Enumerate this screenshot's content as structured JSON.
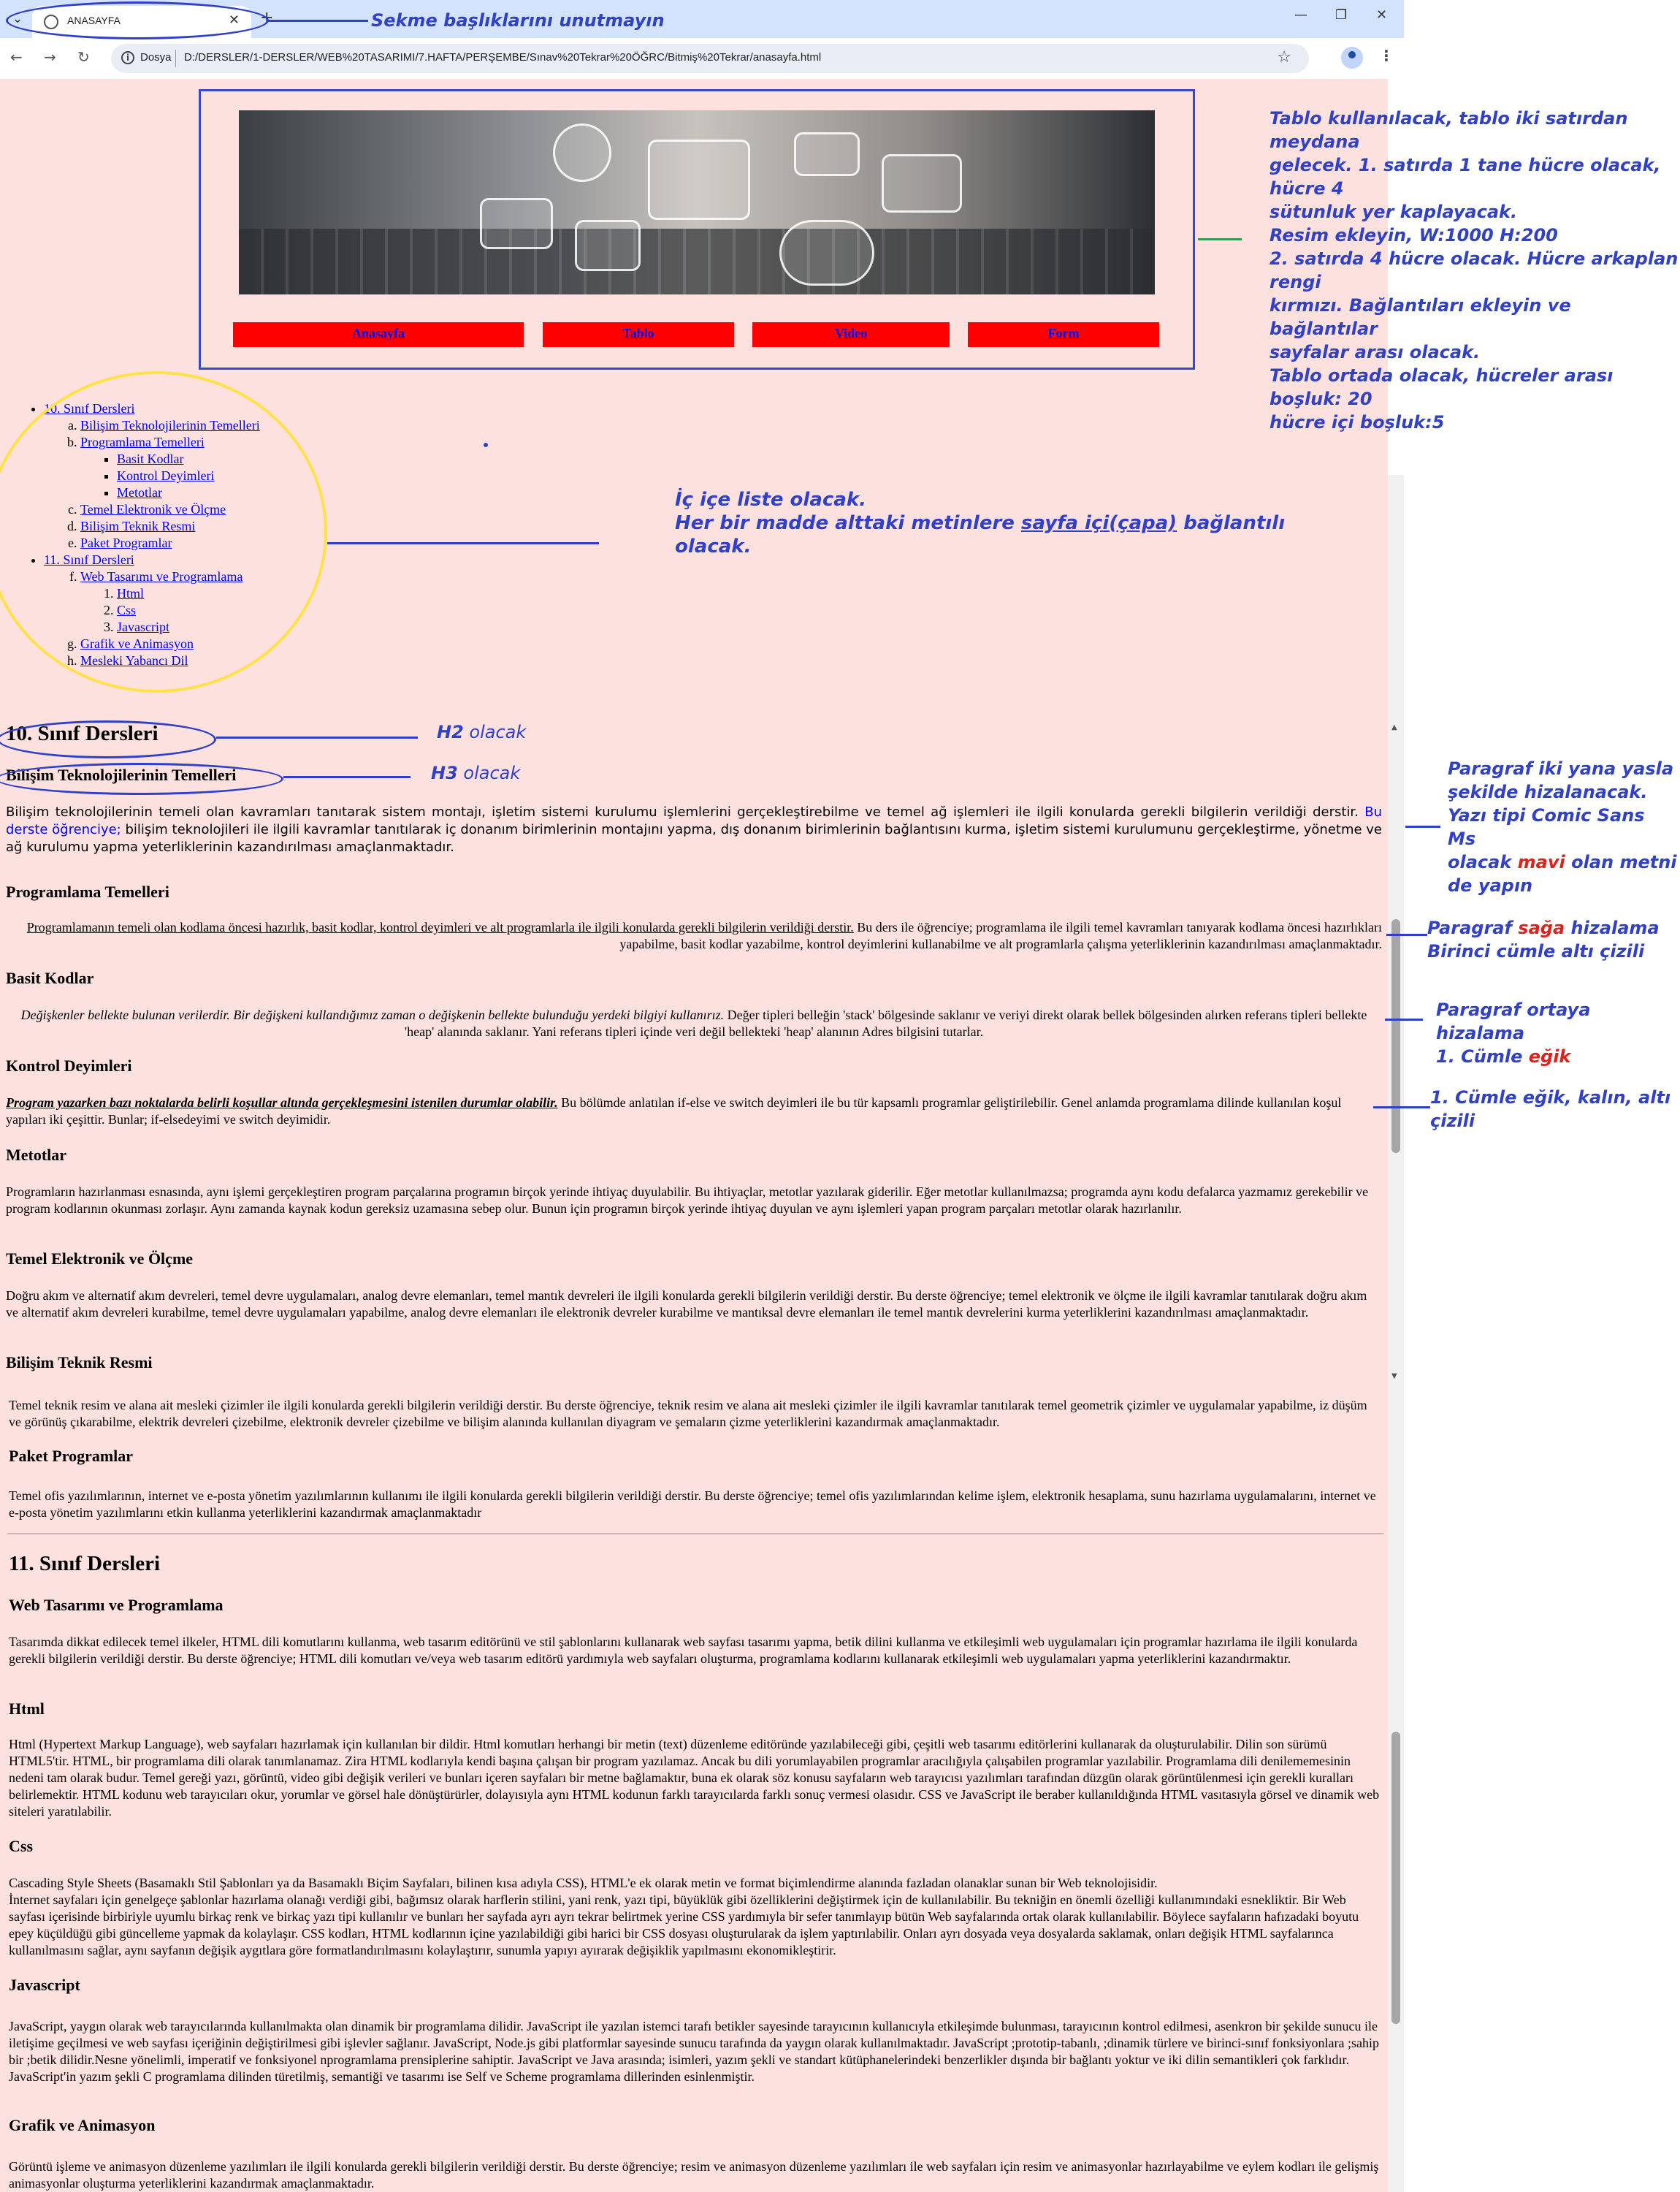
{
  "browser": {
    "tab_title": "ANASAYFA",
    "new_tab": "+",
    "close_tab": "✕",
    "minimize": "—",
    "restore": "❐",
    "close_window": "✕",
    "back": "←",
    "forward": "→",
    "reload": "↻",
    "info_badge": "i",
    "url_label": "Dosya",
    "url": "D:/DERSLER/1-DERSLER/WEB%20TASARIMI/7.HAFTA/PERŞEMBE/Sınav%20Tekrar%20ÖĞRC/Bitmiş%20Tekrar/anasayfa.html",
    "star": "☆",
    "kebab": "⋮",
    "chevron": "⌄"
  },
  "menu": [
    "Anasayfa",
    "Tablo",
    "Video",
    "Form"
  ],
  "list": {
    "grade10": "10. Sınıf Dersleri",
    "grade10_items": [
      {
        "label": "Bilişim Teknolojilerinin Temelleri"
      },
      {
        "label": "Programlama Temelleri",
        "children": [
          "Basit Kodlar",
          "Kontrol Deyimleri",
          "Metotlar"
        ]
      },
      {
        "label": "Temel Elektronik ve Ölçme"
      },
      {
        "label": "Bilişim Teknik Resmi"
      },
      {
        "label": "Paket Programlar"
      }
    ],
    "grade11": "11. Sınıf Dersleri",
    "grade11_items": [
      {
        "label": "Web Tasarımı ve Programlama",
        "children": [
          "Html",
          "Css",
          "Javascript"
        ]
      },
      {
        "label": "Grafik ve Animasyon"
      },
      {
        "label": "Mesleki Yabancı Dil"
      }
    ]
  },
  "content": {
    "h2_10": "10. Sınıf Dersleri",
    "h3_bt": "Bilişim Teknolojilerinin Temelleri",
    "p_bt_1": "Bilişim teknolojilerinin temeli olan kavramları tanıtarak sistem montajı, işletim sistemi kurulumu işlemlerini gerçekleştirebilme ve temel ağ işlemleri ile ilgili konularda gerekli bilgilerin verildiği derstir. ",
    "p_bt_blue": "Bu derste öğrenciye;",
    "p_bt_2": " bilişim teknolojileri ile ilgili kavramlar tanıtılarak iç donanım birimlerinin montajını yapma, dış donanım birimlerinin bağlantısını kurma, işletim sistemi kurulumunu gerçekleştirme, yönetme ve ağ kurulumu yapma yeterliklerinin kazandırılması amaçlanmaktadır.",
    "h3_pt": "Programlama Temelleri",
    "p_pt_u": "Programlamanın temeli olan kodlama öncesi hazırlık, basit kodlar, kontrol deyimleri ve alt programlarla ile ilgili konularda gerekli bilgilerin verildiği derstir.",
    "p_pt_2": " Bu ders ile öğrenciye; programlama ile ilgili temel kavramları tanıyarak kodlama öncesi hazırlıkları yapabilme, basit kodlar yazabilme, kontrol deyimlerini kullanabilme ve alt programlarla çalışma yeterliklerinin kazandırılması amaçlanmaktadır.",
    "h3_bk": "Basit Kodlar",
    "p_bk_i": "Değişkenler bellekte bulunan verilerdir. Bir değişkeni kullandığımız zaman o değişkenin bellekte bulunduğu yerdeki bilgiyi kullanırız.",
    "p_bk_2": " Değer tipleri belleğin 'stack' bölgesinde saklanır ve veriyi direkt olarak bellek bölgesinden alırken referans tipleri bellekte 'heap' alanında saklanır. Yani referans tipleri içinde veri değil bellekteki 'heap' alanının Adres bilgisini tutarlar.",
    "h3_kd": "Kontrol Deyimleri",
    "p_kd_biu": "Program yazarken bazı noktalarda belirli koşullar altında gerçekleşmesini istenilen durumlar olabilir.",
    "p_kd_2": " Bu bölümde anlatılan if-else ve switch deyimleri ile bu tür kapsamlı programlar geliştirilebilir. Genel anlamda programlama dilinde kullanılan koşul yapıları iki çeşittir. Bunlar; if-elsedeyimi ve switch deyimidir.",
    "h3_mt": "Metotlar",
    "p_mt": "Programların hazırlanması esnasında, aynı işlemi gerçekleştiren program parçalarına programın birçok yerinde ihtiyaç duyulabilir. Bu ihtiyaçlar, metotlar yazılarak giderilir. Eğer metotlar kullanılmazsa; programda aynı kodu defalarca yazmamız gerekebilir ve program kodlarının okunması zorlaşır. Aynı zamanda kaynak kodun gereksiz uzamasına sebep olur. Bunun için programın birçok yerinde ihtiyaç duyulan ve aynı işlemleri yapan program parçaları metotlar olarak hazırlanılır.",
    "h3_te": "Temel Elektronik ve Ölçme",
    "p_te": "Doğru akım ve alternatif akım devreleri, temel devre uygulamaları, analog devre elemanları, temel mantık devreleri ile ilgili konularda gerekli bilgilerin verildiği derstir. Bu derste öğrenciye; temel elektronik ve ölçme ile ilgili kavramlar tanıtılarak doğru akım ve alternatif akım devreleri kurabilme, temel devre uygulamaları yapabilme, analog devre elemanları ile elektronik devreler kurabilme ve mantıksal devre elemanları ile temel mantık devrelerini kurma yeterliklerini kazandırılması amaçlanmaktadır.",
    "h3_tr": "Bilişim Teknik Resmi",
    "p_tr": "Temel teknik resim ve alana ait mesleki çizimler ile ilgili konularda gerekli bilgilerin verildiği derstir. Bu derste öğrenciye, teknik resim ve alana ait mesleki çizimler ile ilgili kavramlar tanıtılarak temel geometrik çizimler ve uygulamalar yapabilme, iz düşüm ve görünüş çıkarabilme, elektrik devreleri çizebilme, elektronik devreler çizebilme ve bilişim alanında kullanılan diyagram ve şemaların çizme yeterliklerini kazandırmak amaçlanmaktadır.",
    "h3_pp": "Paket Programlar",
    "p_pp": "Temel ofis yazılımlarının, internet ve e-posta yönetim yazılımlarının kullanımı ile ilgili konularda gerekli bilgilerin verildiği derstir. Bu derste öğrenciye; temel ofis yazılımlarından kelime işlem, elektronik hesaplama, sunu hazırlama uygulamalarını, internet ve e-posta yönetim yazılımlarını etkin kullanma yeterliklerini kazandırmak amaçlanmaktadır",
    "h2_11": "11. Sınıf Dersleri",
    "h3_wt": "Web Tasarımı ve Programlama",
    "p_wt": "Tasarımda dikkat edilecek temel ilkeler, HTML dili komutlarını kullanma, web tasarım editörünü ve stil şablonlarını kullanarak web sayfası tasarımı yapma, betik dilini kullanma ve etkileşimli web uygulamaları için programlar hazırlama ile ilgili konularda gerekli bilgilerin verildiği derstir. Bu derste öğrenciye; HTML dili komutları ve/veya web tasarım editörü yardımıyla web sayfaları oluşturma, programlama kodlarını kullanarak etkileşimli web uygulamaları yapma yeterliklerini kazandırmaktır.",
    "h3_html": "Html",
    "p_html": "Html (Hypertext Markup Language), web sayfaları hazırlamak için kullanılan bir dildir. Html komutları herhangi bir metin (text) düzenleme editöründe yazılabileceği gibi, çeşitli web tasarımı editörlerini kullanarak da oluşturulabilir. Dilin son sürümü HTML5'tir. HTML, bir programlama dili olarak tanımlanamaz. Zira HTML kodlarıyla kendi başına çalışan bir program yazılamaz. Ancak bu dili yorumlayabilen programlar aracılığıyla çalışabilen programlar yazılabilir. Programlama dili denilememesinin nedeni tam olarak budur. Temel gereği yazı, görüntü, video gibi değişik verileri ve bunları içeren sayfaları bir metne bağlamaktır, buna ek olarak söz konusu sayfaların web tarayıcısı yazılımları tarafından düzgün olarak görüntülenmesi için gerekli kuralları belirlemektir. HTML kodunu web tarayıcıları okur, yorumlar ve görsel hale dönüştürürler, dolayısıyla aynı HTML kodunun farklı tarayıcılarda farklı sonuç vermesi olasıdır. CSS ve JavaScript ile beraber kullanıldığında HTML vasıtasıyla görsel ve dinamik web siteleri yaratılabilir.",
    "h3_css": "Css",
    "p_css_1": "Cascading Style Sheets (Basamaklı Stil Şablonları ya da Basamaklı Biçim Sayfaları, bilinen kısa adıyla CSS), HTML'e ek olarak metin ve format biçimlendirme alanında fazladan olanaklar sunan bir Web teknolojisidir.",
    "p_css_2": "İnternet sayfaları için genelgeçe şablonlar hazırlama olanağı verdiği gibi, bağımsız olarak harflerin stilini, yani renk, yazı tipi, büyüklük gibi özelliklerini değiştirmek için de kullanılabilir. Bu tekniğin en önemli özelliği kullanımındaki esnekliktir. Bir Web sayfası içerisinde birbiriyle uyumlu birkaç renk ve birkaç yazı tipi kullanılır ve bunları her sayfada ayrı ayrı tekrar belirtmek yerine CSS yardımıyla bir sefer tanımlayıp bütün Web sayfalarında ortak olarak kullanılabilir. Böylece sayfaların hafızadaki boyutu epey küçüldüğü gibi güncelleme yapmak da kolaylaşır. CSS kodları, HTML kodlarının içine yazılabildiği gibi harici bir CSS dosyası oluşturularak da işlem yaptırılabilir. Onları ayrı dosyada veya dosyalarda saklamak, onları değişik HTML sayfalarınca kullanılmasını sağlar, aynı sayfanın değişik aygıtlara göre formatlandırılmasını kolaylaştırır, sunumla yapıyı ayırarak değişiklik yapılmasını ekonomikleştirir.",
    "h3_js": "Javascript",
    "p_js": "JavaScript, yaygın olarak web tarayıcılarında kullanılmakta olan dinamik bir programlama dilidir. JavaScript ile yazılan istemci tarafı betikler sayesinde tarayıcının kullanıcıyla etkileşimde bulunması, tarayıcının kontrol edilmesi, asenkron bir şekilde sunucu ile iletişime geçilmesi ve web sayfası içeriğinin değiştirilmesi gibi işlevler sağlanır. JavaScript, Node.js gibi platformlar sayesinde sunucu tarafında da yaygın olarak kullanılmaktadır. JavaScript ;prototip-tabanlı, ;dinamik türlere ve birinci-sınıf fonksiyonlara ;sahip bir ;betik dilidir.Nesne yönelimli, imperatif ve fonksiyonel nprogramlama prensiplerine sahiptir. JavaScript ve Java arasında; isimleri, yazım şekli ve standart kütüphanelerindeki benzerlikler dışında bir bağlantı yoktur ve iki dilin semantikleri çok farklıdır. JavaScript'in yazım şekli C programlama dilinden türetilmiş, semantiği ve tasarımı ise Self ve Scheme programlama dillerinden esinlenmiştir.",
    "h3_ga": "Grafik ve Animasyon",
    "p_ga": "Görüntü işleme ve animasyon düzenleme yazılımları ile ilgili konularda gerekli bilgilerin verildiği derstir. Bu derste öğrenciye; resim ve animasyon düzenleme yazılımları ile web sayfaları için resim ve animasyonlar hazırlayabilme ve eylem kodları ile gelişmiş animasyonlar oluşturma yeterliklerini kazandırmak amaçlanmaktadır."
  },
  "annotations": {
    "tabs": "Sekme başlıklarını unutmayın",
    "table": [
      "Tablo kullanılacak, tablo iki satırdan meydana",
      "gelecek. 1. satırda 1 tane hücre olacak, hücre 4",
      "sütunluk yer kaplayacak.",
      "Resim ekleyin, W:1000  H:200",
      "2. satırda 4 hücre olacak. Hücre arkaplan rengi",
      "kırmızı. Bağlantıları ekleyin ve bağlantılar",
      "sayfalar arası olacak.",
      "Tablo ortada olacak, hücreler arası boşluk: 20",
      "hücre içi boşluk:5"
    ],
    "list_1": "İç içe liste olacak.",
    "list_2a": "Her bir madde alttaki metinlere ",
    "list_2u": "sayfa içi(çapa)",
    "list_2b": " bağlantılı olacak.",
    "h2": "H2",
    "h2_rest": " olacak",
    "h3": "H3",
    "h3_rest": " olacak",
    "justify": [
      "Paragraf iki yana yasla",
      "şekilde hizalanacak.",
      "Yazı tipi Comic Sans Ms"
    ],
    "justify_4a": "olacak ",
    "justify_4r": "mavi",
    "justify_4b": " olan metni",
    "justify_5": "de yapın",
    "right_1a": "Paragraf ",
    "right_1r": "sağa",
    "right_1b": " hizalama",
    "right_2": "Birinci cümle altı çizili",
    "center_1": "Paragraf ortaya hizalama",
    "center_2a": " 1. Cümle ",
    "center_2r": "eğik",
    "bold_1": "1. Cümle eğik, kalın, altı",
    "bold_2": "çizili"
  }
}
